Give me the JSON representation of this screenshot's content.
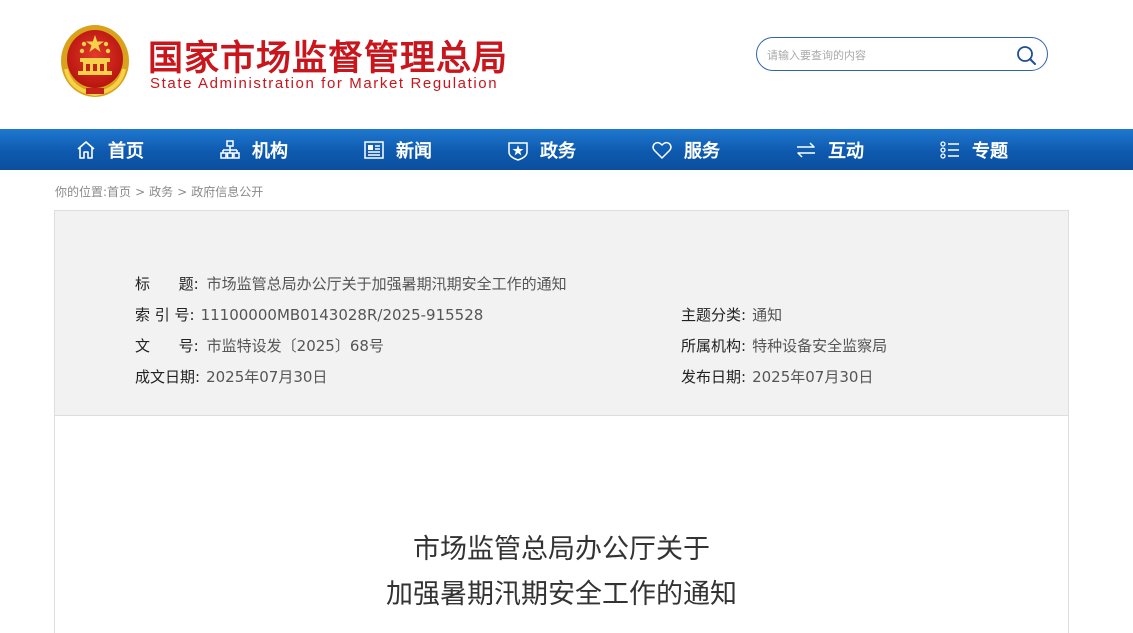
{
  "header": {
    "site_name_cn": "国家市场监督管理总局",
    "site_name_en": "State Administration for Market Regulation",
    "search": {
      "placeholder": "请输入要查询的内容",
      "value": ""
    }
  },
  "nav": {
    "items": [
      {
        "label": "首页",
        "icon": "home-icon"
      },
      {
        "label": "机构",
        "icon": "org-chart-icon"
      },
      {
        "label": "新闻",
        "icon": "news-icon"
      },
      {
        "label": "政务",
        "icon": "shield-star-icon"
      },
      {
        "label": "服务",
        "icon": "heart-icon"
      },
      {
        "label": "互动",
        "icon": "exchange-arrows-icon"
      },
      {
        "label": "专题",
        "icon": "topic-list-icon"
      }
    ]
  },
  "breadcrumb": {
    "prefix": "你的位置:",
    "items": [
      "首页",
      "政务",
      "政府信息公开"
    ],
    "separator": ">"
  },
  "meta": {
    "title_label": "标      题:",
    "title_value": "市场监管总局办公厅关于加强暑期汛期安全工作的通知",
    "index_label": "索 引 号:",
    "index_value": "11100000MB0143028R/2025-915528",
    "topic_label": "主题分类:",
    "topic_value": "通知",
    "docno_label": "文      号:",
    "docno_value": "市监特设发〔2025〕68号",
    "org_label": "所属机构:",
    "org_value": "特种设备安全监察局",
    "written_label": "成文日期:",
    "written_value": "2025年07月30日",
    "published_label": "发布日期:",
    "published_value": "2025年07月30日"
  },
  "document": {
    "title_line1": "市场监管总局办公厅关于",
    "title_line2": "加强暑期汛期安全工作的通知"
  },
  "colors": {
    "brand_red": "#c9161d",
    "nav_blue": "#0e5aaf",
    "search_border": "#2e64a8",
    "panel_bg": "#f2f2f2"
  }
}
